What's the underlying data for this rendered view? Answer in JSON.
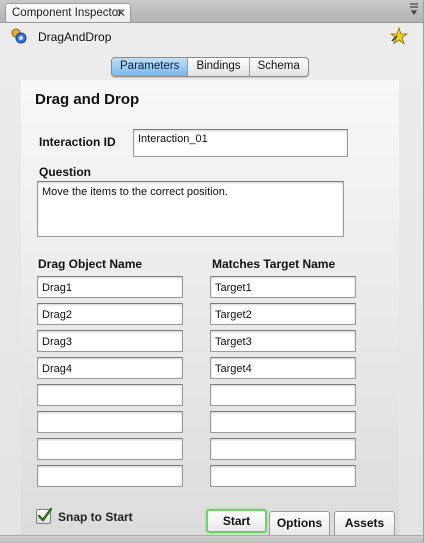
{
  "panel": {
    "tab_title": "Component Inspector",
    "close_glyph": "✕",
    "menu_glyph": "⇕"
  },
  "header": {
    "component_name": "DragAndDrop",
    "component_icon": "component-icon",
    "star_icon": "star-icon"
  },
  "segments": [
    {
      "label": "Parameters",
      "active": true
    },
    {
      "label": "Bindings",
      "active": false
    },
    {
      "label": "Schema",
      "active": false
    }
  ],
  "form": {
    "title": "Drag and Drop",
    "interaction_id_label": "Interaction ID",
    "interaction_id_value": "Interaction_01",
    "question_label": "Question",
    "question_value": "Move the items to the correct position.",
    "drag_header": "Drag Object Name",
    "target_header": "Matches Target Name",
    "rows": [
      {
        "drag": "Drag1",
        "target": "Target1"
      },
      {
        "drag": "Drag2",
        "target": "Target2"
      },
      {
        "drag": "Drag3",
        "target": "Target3"
      },
      {
        "drag": "Drag4",
        "target": "Target4"
      },
      {
        "drag": "",
        "target": ""
      },
      {
        "drag": "",
        "target": ""
      },
      {
        "drag": "",
        "target": ""
      },
      {
        "drag": "",
        "target": ""
      }
    ]
  },
  "footer": {
    "snap_label": "Snap to Start",
    "snap_checked": true,
    "tabs": [
      {
        "label": "Start",
        "active": true
      },
      {
        "label": "Options",
        "active": false
      },
      {
        "label": "Assets",
        "active": false
      }
    ]
  }
}
